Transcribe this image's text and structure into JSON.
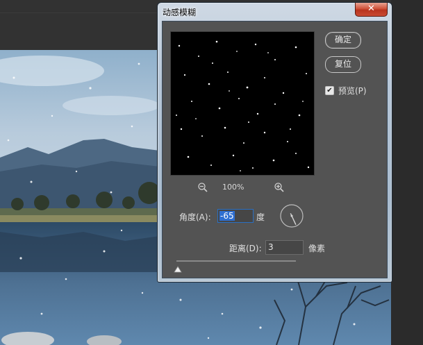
{
  "dialog": {
    "title": "动感模糊",
    "close_glyph": "✕",
    "buttons": {
      "ok": "确定",
      "reset": "复位"
    },
    "preview_checkbox": {
      "label": "预览(P)",
      "checked": true
    },
    "zoom": {
      "out_icon": "zoom-out-icon",
      "in_icon": "zoom-in-icon",
      "level": "100%"
    },
    "angle": {
      "label": "角度(A):",
      "value": "-65",
      "unit": "度"
    },
    "distance": {
      "label": "距离(D):",
      "value": "3",
      "unit": "像素",
      "slider_fraction": 0.01
    }
  },
  "colors": {
    "dialog_body": "#535353",
    "selection": "#2f6fd1",
    "close_button": "#c94a31"
  }
}
